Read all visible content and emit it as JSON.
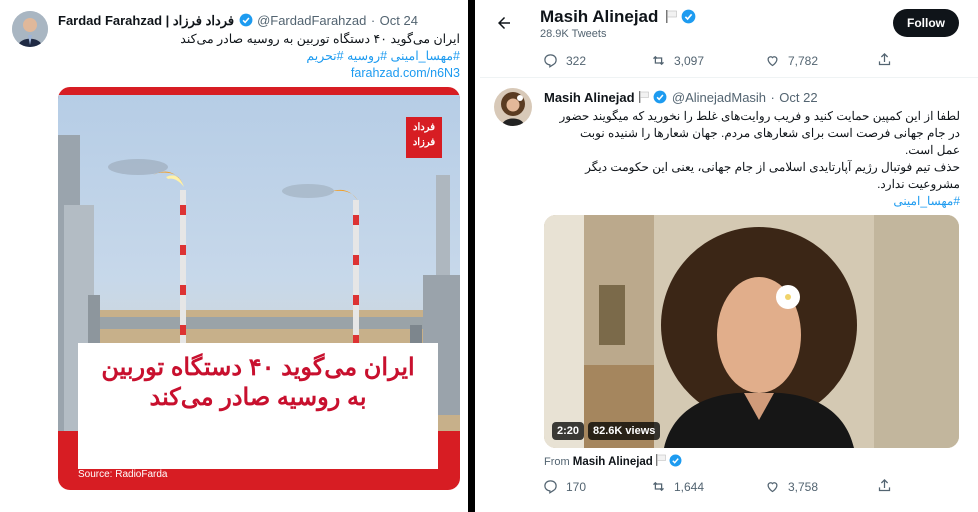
{
  "left_tweet": {
    "author_name": "Fardad Farahzad | فرداد فرزاد",
    "handle": "@FardadFarahzad",
    "sep": "·",
    "date": "Oct 24",
    "text": "ایران می‌گوید ۴۰ دستگاه توربین به روسیه صادر می‌کند",
    "hashtags": "#مهسا_امینی #روسیه #تحریم",
    "link": "farahzad.com/n6N3",
    "image": {
      "logo_line1": "فرداد",
      "logo_line2": "فرزاد",
      "headline_line1": "ایران می‌گوید ۴۰ دستگاه توربین",
      "headline_line2": "به روسیه صادر می‌کند",
      "source": "Source: RadioFarda"
    }
  },
  "right_profile": {
    "name": "Masih Alinejad",
    "tweet_count": "28.9K Tweets",
    "follow_label": "Follow",
    "top_stats": {
      "replies": "322",
      "retweets": "3,097",
      "likes": "7,782"
    }
  },
  "right_tweet": {
    "author_name": "Masih Alinejad",
    "handle": "@AlinejadMasih",
    "sep": "·",
    "date": "Oct 22",
    "text_line1": "لطفا از این کمپین حمایت کنید و فریب روایت‌های غلط را نخورید که میگویند حضور",
    "text_line2": "در جام جهانی فرصت است برای شعارهای مردم. جهان شعارها را شنیده نوبت",
    "text_line3": "عمل است.",
    "text_line4": "حذف تیم فوتبال رژیم آپارتایدی اسلامی از جام جهانی، یعنی این حکومت دیگر",
    "text_line5": "مشروعیت ندارد.",
    "hashtag": "#مهسا_امینی",
    "video": {
      "duration": "2:20",
      "views": "82.6K views"
    },
    "from_label": "From",
    "from_name": "Masih Alinejad",
    "stats": {
      "replies": "170",
      "retweets": "1,644",
      "likes": "3,758"
    }
  },
  "colors": {
    "accent": "#1d9bf0",
    "headline_red": "#c8102e",
    "image_red": "#d71d23"
  }
}
